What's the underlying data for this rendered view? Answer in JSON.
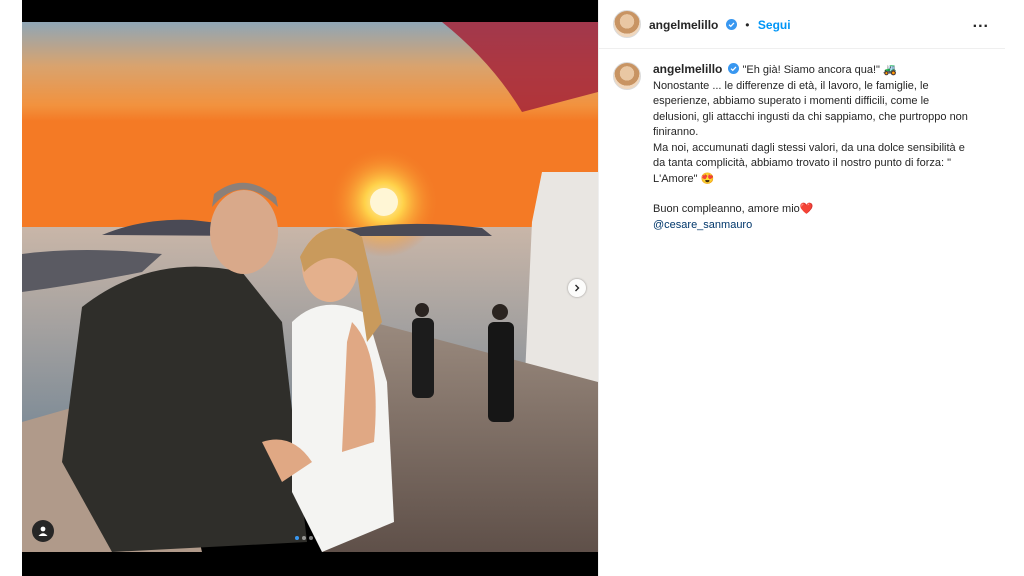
{
  "post": {
    "username": "angelmelillo",
    "follow_label": "Segui",
    "more_label": "...",
    "bullet": "•"
  },
  "caption": {
    "username": "angelmelillo",
    "line1": "\"Eh già! Siamo ancora qua!\" ",
    "emoji1": "🚜",
    "para1": "Nonostante ... le differenze di età, il lavoro, le famiglie, le esperienze, abbiamo superato i momenti difficili, come le delusioni, gli attacchi ingusti da chi sappiamo, che purtroppo non finiranno.",
    "para2": "Ma noi, accumunati dagli stessi valori, da una dolce sensibilità e da tanta complicità, abbiamo trovato il nostro punto di forza: \" L'Amore\" ",
    "emoji2": "😍",
    "para3": "Buon compleanno, amore mio",
    "emoji3": "❤️",
    "mention": "@cesare_sanmauro"
  },
  "carousel": {
    "total_slides": 4,
    "active_slide": 1
  },
  "colors": {
    "accent": "#0095f6",
    "verified": "#3897f0",
    "mention": "#00376b"
  }
}
